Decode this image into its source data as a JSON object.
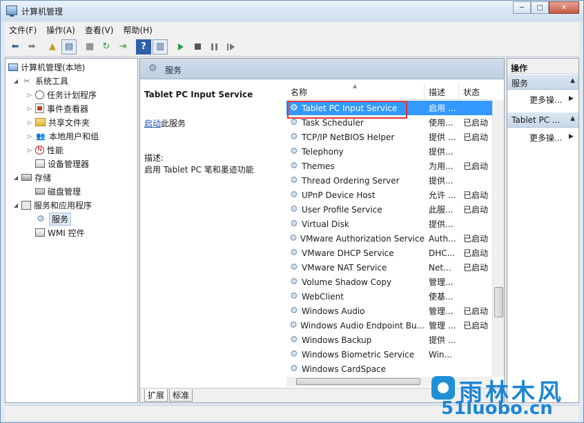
{
  "window": {
    "title": "计算机管理",
    "minimize": "─",
    "maximize": "□",
    "close": "✕"
  },
  "menu": [
    "文件(F)",
    "操作(A)",
    "查看(V)",
    "帮助(H)"
  ],
  "tree": {
    "root": "计算机管理(本地)",
    "system_tools": "系统工具",
    "task_scheduler": "任务计划程序",
    "event_viewer": "事件查看器",
    "shared_folders": "共享文件夹",
    "local_users": "本地用户和组",
    "performance": "性能",
    "device_manager": "设备管理器",
    "storage": "存储",
    "disk_management": "磁盘管理",
    "services_apps": "服务和应用程序",
    "services": "服务",
    "wmi": "WMI 控件"
  },
  "center": {
    "header_title": "服务",
    "service_title": "Tablet PC Input Service",
    "start_link": "启动",
    "start_suffix": "此服务",
    "desc_label": "描述:",
    "desc_text": "启用 Tablet PC 笔和墨迹功能"
  },
  "list": {
    "columns": [
      "名称",
      "描述",
      "状态"
    ],
    "rows": [
      {
        "name": "Tablet PC Input Service",
        "desc": "启用 ...",
        "status": ""
      },
      {
        "name": "Task Scheduler",
        "desc": "使用...",
        "status": "已启动"
      },
      {
        "name": "TCP/IP NetBIOS Helper",
        "desc": "提供 ...",
        "status": "已启动"
      },
      {
        "name": "Telephony",
        "desc": "提供...",
        "status": ""
      },
      {
        "name": "Themes",
        "desc": "为用...",
        "status": "已启动"
      },
      {
        "name": "Thread Ordering Server",
        "desc": "提供...",
        "status": ""
      },
      {
        "name": "UPnP Device Host",
        "desc": "允许 ...",
        "status": "已启动"
      },
      {
        "name": "User Profile Service",
        "desc": "此服...",
        "status": "已启动"
      },
      {
        "name": "Virtual Disk",
        "desc": "提供...",
        "status": ""
      },
      {
        "name": "VMware Authorization Service",
        "desc": "Auth...",
        "status": "已启动"
      },
      {
        "name": "VMware DHCP Service",
        "desc": "DHC...",
        "status": "已启动"
      },
      {
        "name": "VMware NAT Service",
        "desc": "Net...",
        "status": "已启动"
      },
      {
        "name": "Volume Shadow Copy",
        "desc": "管理...",
        "status": ""
      },
      {
        "name": "WebClient",
        "desc": "使基...",
        "status": ""
      },
      {
        "name": "Windows Audio",
        "desc": "管理...",
        "status": "已启动"
      },
      {
        "name": "Windows Audio Endpoint Bu...",
        "desc": "管理 ...",
        "status": "已启动"
      },
      {
        "name": "Windows Backup",
        "desc": "提供 ...",
        "status": ""
      },
      {
        "name": "Windows Biometric Service",
        "desc": "Win...",
        "status": ""
      },
      {
        "name": "Windows CardSpace",
        "desc": "",
        "status": ""
      }
    ]
  },
  "tabs": [
    "扩展",
    "标准"
  ],
  "actions": {
    "header": "操作",
    "section1": "服务",
    "more1": "更多操...",
    "section2": "Tablet PC ...",
    "more2": "更多操..."
  },
  "watermark": {
    "cn": "雨林木风",
    "url": "51luobo.cn"
  },
  "colors": {
    "selection": "#3399ff",
    "highlight_box": "#e0343a",
    "link": "#1a55b8"
  }
}
